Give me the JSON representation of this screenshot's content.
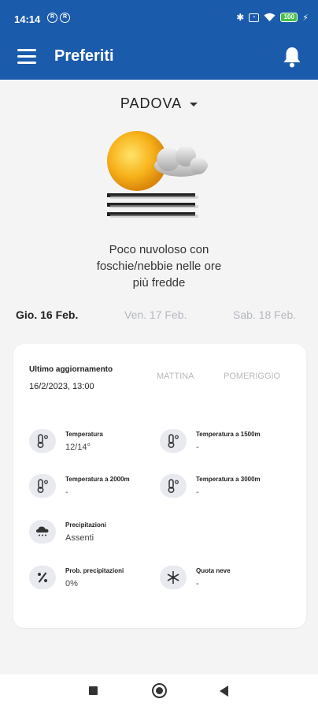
{
  "status_bar": {
    "time": "14:14",
    "battery": "100"
  },
  "app_bar": {
    "title": "Preferiti"
  },
  "location": {
    "city": "PADOVA"
  },
  "forecast": {
    "description": "Poco nuvoloso con\nfoschie/nebbie nelle ore\npiù fredde"
  },
  "days": [
    {
      "label": "Gio. 16 Feb.",
      "active": true
    },
    {
      "label": "Ven. 17 Feb.",
      "active": false
    },
    {
      "label": "Sab. 18 Feb.",
      "active": false
    }
  ],
  "card": {
    "update_label": "Ultimo aggiornamento",
    "update_value": "16/2/2023, 13:00",
    "periods": [
      "MATTINA",
      "POMERIGGIO"
    ],
    "items": [
      {
        "icon": "thermometer-icon",
        "label": "Temperatura",
        "value": "12/14°"
      },
      {
        "icon": "thermometer-icon",
        "label": "Temperatura a 1500m",
        "value": "-"
      },
      {
        "icon": "thermometer-icon",
        "label": "Temperatura a 2000m",
        "value": "-"
      },
      {
        "icon": "thermometer-icon",
        "label": "Temperatura a 3000m",
        "value": "-"
      },
      {
        "icon": "rain-cloud-icon",
        "label": "Precipitazioni",
        "value": "Assenti"
      },
      {
        "icon": "percent-icon",
        "label": "Prob. precipitazioni",
        "value": "0%"
      },
      {
        "icon": "snowflake-icon",
        "label": "Quota neve",
        "value": "-"
      }
    ]
  },
  "colors": {
    "primary": "#1b5bab",
    "background": "#f4f4f5",
    "inactive": "#b5b8bd",
    "battery": "#44c04a"
  }
}
